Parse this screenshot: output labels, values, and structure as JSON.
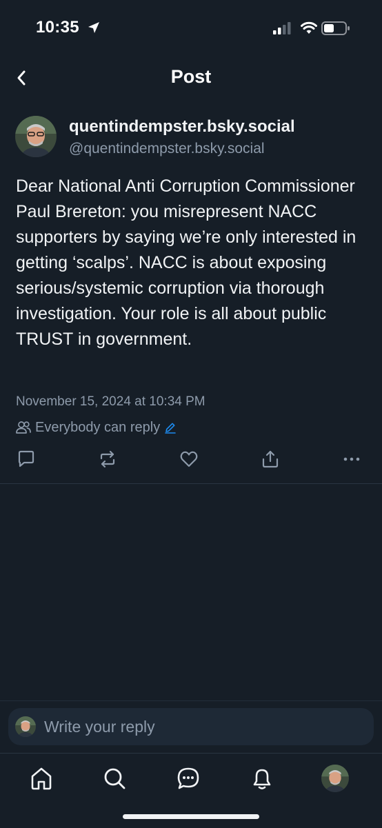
{
  "status_bar": {
    "time": "10:35"
  },
  "header": {
    "title": "Post"
  },
  "post": {
    "author_name": "quentindempster.bsky.social",
    "author_handle": "@quentindempster.bsky.social",
    "text": "Dear National Anti Corruption Commissioner Paul Brereton: you misrepresent NACC supporters by saying we’re only interested in getting ‘scalps’. NACC is about exposing serious/systemic corruption via thorough investigation. Your role is all about public TRUST in government.",
    "timestamp": "November 15, 2024 at 10:34 PM",
    "reply_setting": "Everybody can reply"
  },
  "composer": {
    "placeholder": "Write your reply"
  },
  "icons": {
    "back": "chevron-left-icon",
    "reply": "speech-bubble-icon",
    "repost": "repost-arrows-icon",
    "like": "heart-icon",
    "share": "share-upload-icon",
    "more": "ellipsis-icon",
    "home": "home-icon",
    "search": "search-icon",
    "chat": "chat-bubble-icon",
    "notifications": "bell-icon"
  },
  "colors": {
    "background": "#161e27",
    "text_primary": "#f1f3f5",
    "text_secondary": "#8e9bab",
    "accent": "#1d8cf0"
  }
}
